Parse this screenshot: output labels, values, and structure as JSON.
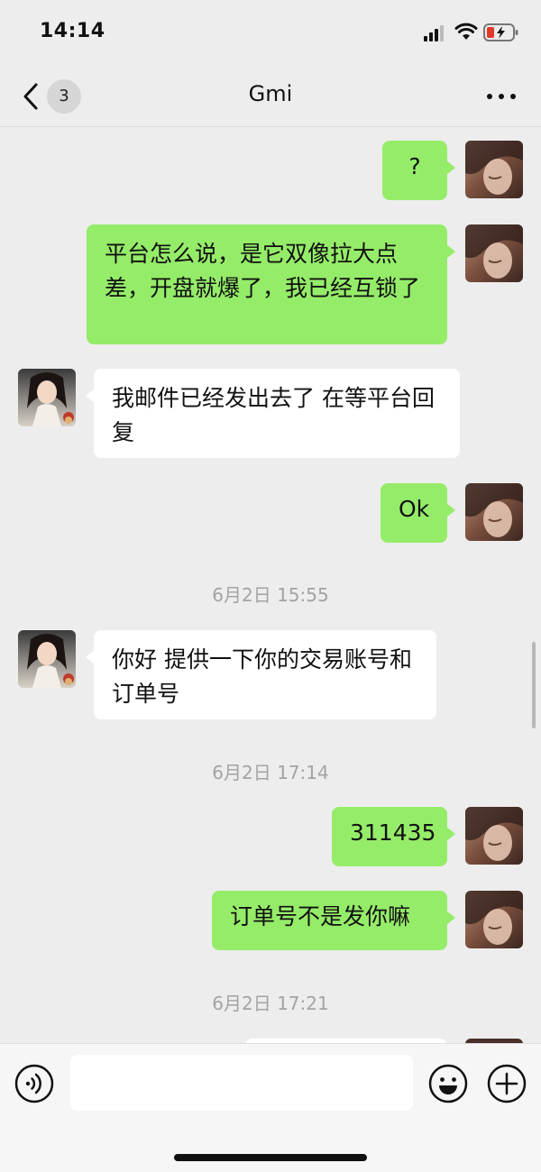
{
  "status": {
    "time": "14:14"
  },
  "header": {
    "back_badge": "3",
    "title": "Gmi"
  },
  "messages": [
    {
      "from": "me",
      "text": "?"
    },
    {
      "from": "me",
      "text": "平台怎么说，是它双像拉大点差，开盘就爆了，我已经互锁了"
    },
    {
      "from": "them",
      "text": "我邮件已经发出去了 在等平台回复"
    },
    {
      "from": "me",
      "text": "Ok"
    },
    {
      "timestamp": "6月2日 15:55"
    },
    {
      "from": "them",
      "text": "你好 提供一下你的交易账号和订单号"
    },
    {
      "timestamp": "6月2日 17:14"
    },
    {
      "from": "me",
      "text": "311435"
    },
    {
      "from": "me",
      "text": "订单号不是发你嘛"
    },
    {
      "timestamp": "6月2日 17:21"
    }
  ],
  "icons": {
    "back": "chevron-left-icon",
    "more": "more-dots-icon",
    "voice": "voice-icon",
    "emoji": "emoji-icon",
    "plus": "plus-icon"
  },
  "colors": {
    "background": "#ededed",
    "my_bubble": "#95ec69",
    "their_bubble": "#ffffff",
    "timestamp": "#a3a3a3"
  }
}
